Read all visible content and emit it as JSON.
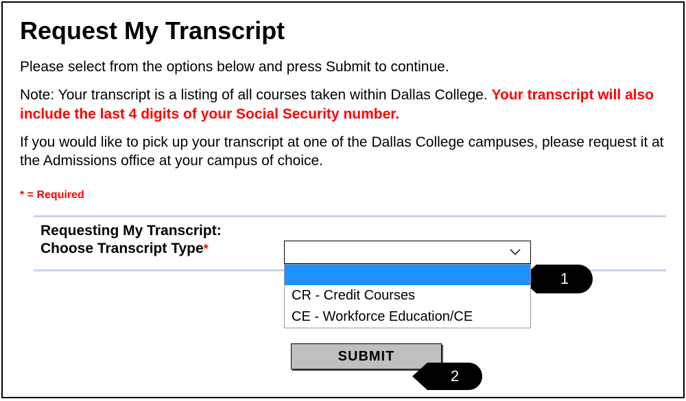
{
  "page": {
    "title": "Request My Transcript",
    "intro": "Please select from the options below and press Submit to continue.",
    "note_prefix": "Note: Your transcript is a listing of all courses taken within Dallas College. ",
    "note_warning": "Your transcript will also include the last 4 digits of your Social Security number.",
    "pickup": "If you would like to pick up your transcript at one of the Dallas College campuses, please request it at the Admissions office at your campus of choice.",
    "required_legend": "* = Required"
  },
  "form": {
    "section_label": "Requesting My Transcript:",
    "type_label": "Choose Transcript Type",
    "required_marker": "*",
    "dropdown": {
      "selected": "",
      "options": [
        {
          "label": "",
          "highlighted": true
        },
        {
          "label": "CR - Credit Courses",
          "highlighted": false
        },
        {
          "label": "CE - Workforce Education/CE",
          "highlighted": false
        }
      ]
    },
    "submit_label": "SUBMIT"
  },
  "callouts": {
    "one": "1",
    "two": "2"
  }
}
